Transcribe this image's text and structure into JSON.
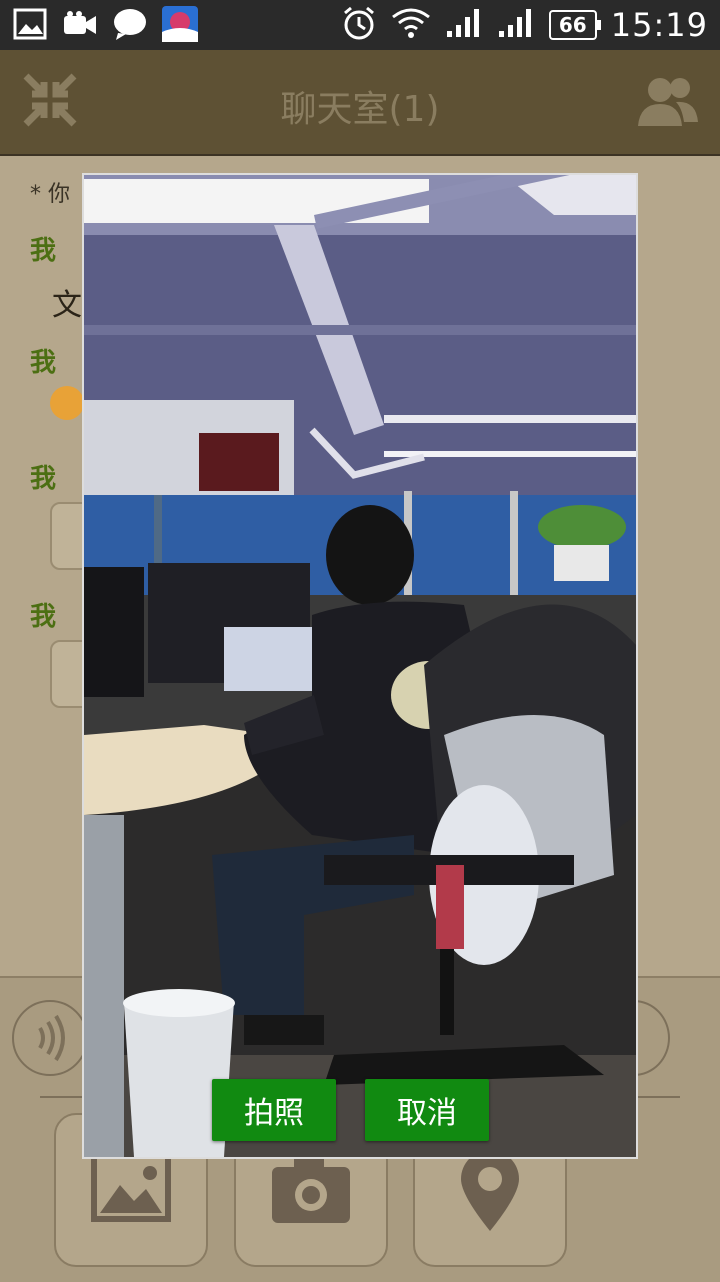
{
  "status_bar": {
    "time": "15:19",
    "battery": "66",
    "icons": [
      "image-notification-icon",
      "video-camera-icon",
      "chat-bubble-icon",
      "app-globe-icon",
      "alarm-icon",
      "wifi-icon",
      "signal-icon",
      "signal-icon",
      "battery-icon"
    ]
  },
  "header": {
    "title": "聊天室(1)",
    "left_icon": "collapse-arrows-icon",
    "right_icon": "group-members-icon"
  },
  "chat": {
    "system_text": "* 你",
    "messages": [
      {
        "sender": "我",
        "content": "文"
      },
      {
        "sender": "我",
        "content": ""
      },
      {
        "sender": "我",
        "content": ""
      },
      {
        "sender": "我",
        "content": ""
      }
    ]
  },
  "bottom_bar": {
    "tools": [
      "image-icon",
      "camera-icon",
      "location-pin-icon"
    ]
  },
  "dialog": {
    "take_photo_label": "拍照",
    "cancel_label": "取消"
  },
  "colors": {
    "accent_green": "#118a11",
    "header_bg": "#5e5134",
    "sender_green": "#4c6f13"
  }
}
